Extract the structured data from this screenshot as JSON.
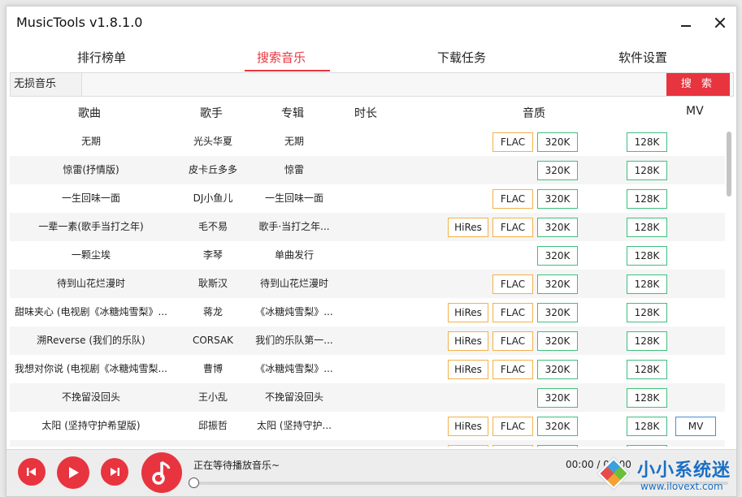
{
  "window": {
    "title": "MusicTools v1.8.1.0"
  },
  "tabs": [
    {
      "label": "排行榜单",
      "active": false
    },
    {
      "label": "搜索音乐",
      "active": true
    },
    {
      "label": "下载任务",
      "active": false
    },
    {
      "label": "软件设置",
      "active": false
    }
  ],
  "search": {
    "keyword_label": "无损音乐",
    "input_value": "",
    "button_label": "搜 索"
  },
  "columns": {
    "song": "歌曲",
    "artist": "歌手",
    "album": "专辑",
    "duration": "时长",
    "quality": "音质",
    "mv": "MV"
  },
  "rows": [
    {
      "song": "无期",
      "artist": "光头华夏",
      "album": "无期",
      "hires": false,
      "flac": true,
      "k320": true,
      "k128": true,
      "mv": false
    },
    {
      "song": "惊雷(抒情版)",
      "artist": "皮卡丘多多",
      "album": "惊雷",
      "hires": false,
      "flac": false,
      "k320": true,
      "k128": true,
      "mv": false
    },
    {
      "song": "一生回味一面",
      "artist": "DJ小鱼儿",
      "album": "一生回味一面",
      "hires": false,
      "flac": true,
      "k320": true,
      "k128": true,
      "mv": false
    },
    {
      "song": "一辈一素(歌手当打之年)",
      "artist": "毛不易",
      "album": "歌手·当打之年...",
      "hires": true,
      "flac": true,
      "k320": true,
      "k128": true,
      "mv": false
    },
    {
      "song": "一颗尘埃",
      "artist": "李琴",
      "album": "单曲发行",
      "hires": false,
      "flac": false,
      "k320": true,
      "k128": true,
      "mv": false
    },
    {
      "song": "待到山花烂漫时",
      "artist": "耿斯汉",
      "album": "待到山花烂漫时",
      "hires": false,
      "flac": true,
      "k320": true,
      "k128": true,
      "mv": false
    },
    {
      "song": "甜味夹心 (电视剧《冰糖炖雪梨》...",
      "artist": "蒋龙",
      "album": "《冰糖炖雪梨》...",
      "hires": true,
      "flac": true,
      "k320": true,
      "k128": true,
      "mv": false
    },
    {
      "song": "溯Reverse (我们的乐队)",
      "artist": "CORSAK",
      "album": "我们的乐队第一...",
      "hires": true,
      "flac": true,
      "k320": true,
      "k128": true,
      "mv": false
    },
    {
      "song": "我想对你说 (电视剧《冰糖炖雪梨...",
      "artist": "曹博",
      "album": "《冰糖炖雪梨》...",
      "hires": true,
      "flac": true,
      "k320": true,
      "k128": true,
      "mv": false
    },
    {
      "song": "不挽留没回头",
      "artist": "王小乱",
      "album": "不挽留没回头",
      "hires": false,
      "flac": false,
      "k320": true,
      "k128": true,
      "mv": false
    },
    {
      "song": "太阳 (坚持守护希望版)",
      "artist": "邱振哲",
      "album": "太阳 (坚持守护...",
      "hires": true,
      "flac": true,
      "k320": true,
      "k128": true,
      "mv": true
    },
    {
      "song": "",
      "artist": "",
      "album": "",
      "hires": true,
      "flac": true,
      "k320": true,
      "k128": true,
      "mv": false
    }
  ],
  "quality_labels": {
    "hires": "HiRes",
    "flac": "FLAC",
    "k320": "320K",
    "k128": "128K",
    "mv": "MV"
  },
  "player": {
    "now_playing": "正在等待播放音乐~",
    "time": "00:00 / 00:00",
    "progress": 0
  },
  "watermark": {
    "name": "小小系统迷",
    "url": "www.ilovext.com"
  },
  "colors": {
    "accent": "#e8343f",
    "hires_border": "#f2b24a",
    "k320_border": "#3fbf7f",
    "mv_border": "#4a8fd6",
    "watermark": "#1a6fc4"
  }
}
